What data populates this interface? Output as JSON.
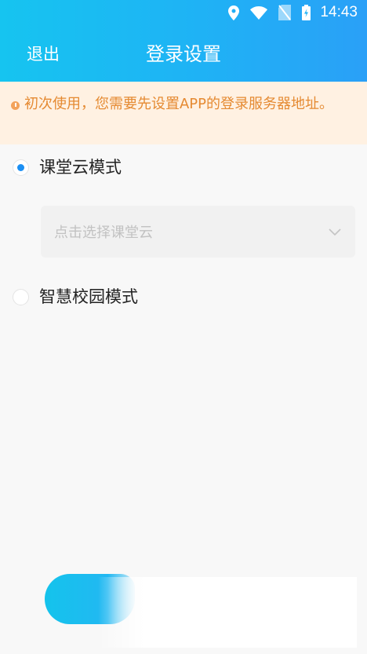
{
  "status_bar": {
    "time": "14:43",
    "icons": [
      "location-icon",
      "wifi-icon",
      "no-sim-icon",
      "battery-charging-icon"
    ]
  },
  "header": {
    "back_label": "退出",
    "title": "登录设置"
  },
  "notice": {
    "icon": "warning-icon",
    "text": "初次使用，您需要先设置APP的登录服务器地址。"
  },
  "options": [
    {
      "label": "课堂云模式",
      "selected": true,
      "select": {
        "placeholder": "点击选择课堂云",
        "icon": "chevron-down-icon"
      }
    },
    {
      "label": "智慧校园模式",
      "selected": false
    }
  ],
  "colors": {
    "accent": "#1b8ff3",
    "header_start": "#16c4f0",
    "header_end": "#2aa0f7",
    "notice_bg": "#fff1e2",
    "notice_text": "#e58a32"
  }
}
